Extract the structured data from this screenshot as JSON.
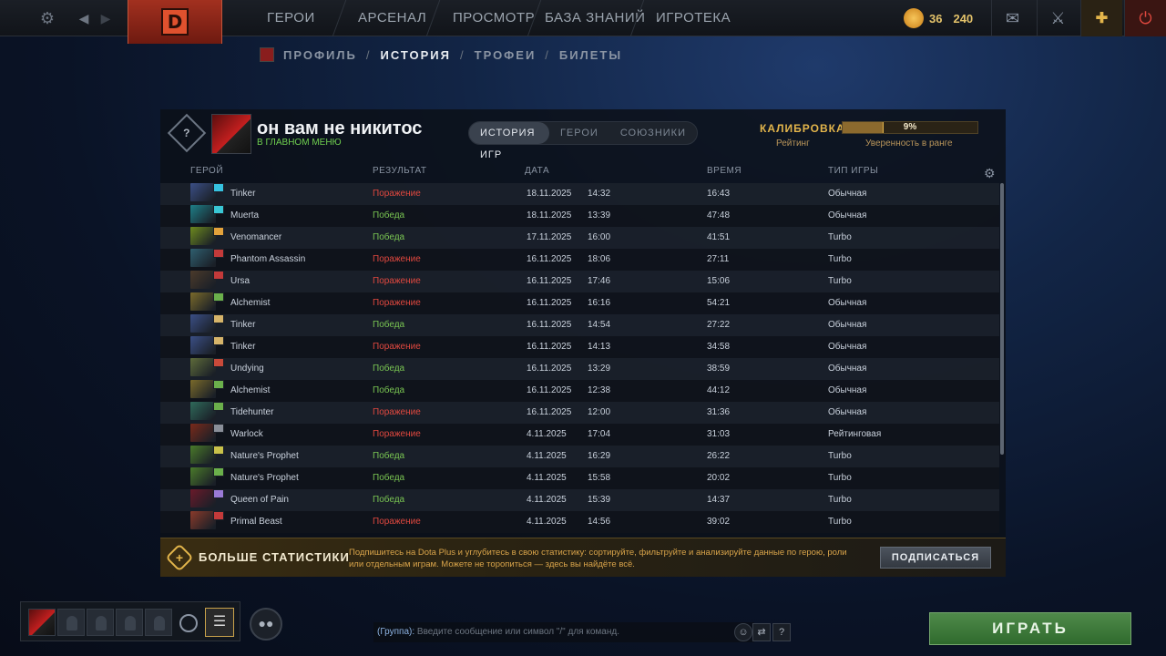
{
  "topbar": {
    "nav": [
      "ГЕРОИ",
      "АРСЕНАЛ",
      "ПРОСМОТР",
      "БАЗА ЗНАНИЙ",
      "ИГРОТЕКА"
    ],
    "currency": {
      "shards": "36",
      "gold": "240"
    }
  },
  "subnav": {
    "items": [
      "ПРОФИЛЬ",
      "ИСТОРИЯ",
      "ТРОФЕИ",
      "БИЛЕТЫ"
    ],
    "active": 1
  },
  "profile": {
    "name": "он вам не никитос",
    "status": "В ГЛАВНОМ МЕНЮ"
  },
  "tabs": [
    "ИСТОРИЯ ИГР",
    "ГЕРОИ",
    "СОЮЗНИКИ"
  ],
  "calibration": {
    "title": "КАЛИБРОВКА",
    "rating_label": "Рейтинг",
    "confidence_label": "Уверенность в ранге",
    "percent": "9%",
    "fraction": 0.3
  },
  "table": {
    "headers": {
      "hero": "ГЕРОЙ",
      "result": "РЕЗУЛЬТАТ",
      "date": "ДАТА",
      "time": "ВРЕМЯ",
      "type": "ТИП ИГРЫ"
    },
    "rows": [
      {
        "hero": "Tinker",
        "result": "Поражение",
        "win": false,
        "date": "18.11.2025",
        "clock": "14:32",
        "duration": "16:43",
        "type": "Обычная",
        "c1": "#3b4f86",
        "c2": "#36c2e0"
      },
      {
        "hero": "Muerta",
        "result": "Победа",
        "win": true,
        "date": "18.11.2025",
        "clock": "13:39",
        "duration": "47:48",
        "type": "Обычная",
        "c1": "#1e7f88",
        "c2": "#39c7d5"
      },
      {
        "hero": "Venomancer",
        "result": "Победа",
        "win": true,
        "date": "17.11.2025",
        "clock": "16:00",
        "duration": "41:51",
        "type": "Turbo",
        "c1": "#6d8a1e",
        "c2": "#e3a23b"
      },
      {
        "hero": "Phantom Assassin",
        "result": "Поражение",
        "win": false,
        "date": "16.11.2025",
        "clock": "18:06",
        "duration": "27:11",
        "type": "Turbo",
        "c1": "#2f5f6f",
        "c2": "#c33a3a"
      },
      {
        "hero": "Ursa",
        "result": "Поражение",
        "win": false,
        "date": "16.11.2025",
        "clock": "17:46",
        "duration": "15:06",
        "type": "Turbo",
        "c1": "#4b3a2a",
        "c2": "#c33a3a"
      },
      {
        "hero": "Alchemist",
        "result": "Поражение",
        "win": false,
        "date": "16.11.2025",
        "clock": "16:16",
        "duration": "54:21",
        "type": "Обычная",
        "c1": "#7a6a2a",
        "c2": "#6bb04b"
      },
      {
        "hero": "Tinker",
        "result": "Победа",
        "win": true,
        "date": "16.11.2025",
        "clock": "14:54",
        "duration": "27:22",
        "type": "Обычная",
        "c1": "#3b4f86",
        "c2": "#d6b46a"
      },
      {
        "hero": "Tinker",
        "result": "Поражение",
        "win": false,
        "date": "16.11.2025",
        "clock": "14:13",
        "duration": "34:58",
        "type": "Обычная",
        "c1": "#3b4f86",
        "c2": "#d6b46a"
      },
      {
        "hero": "Undying",
        "result": "Победа",
        "win": true,
        "date": "16.11.2025",
        "clock": "13:29",
        "duration": "38:59",
        "type": "Обычная",
        "c1": "#5e6b3a",
        "c2": "#c94a3a"
      },
      {
        "hero": "Alchemist",
        "result": "Победа",
        "win": true,
        "date": "16.11.2025",
        "clock": "12:38",
        "duration": "44:12",
        "type": "Обычная",
        "c1": "#7a6a2a",
        "c2": "#6bb04b"
      },
      {
        "hero": "Tidehunter",
        "result": "Поражение",
        "win": false,
        "date": "16.11.2025",
        "clock": "12:00",
        "duration": "31:36",
        "type": "Обычная",
        "c1": "#2f6a5a",
        "c2": "#6bb04b"
      },
      {
        "hero": "Warlock",
        "result": "Поражение",
        "win": false,
        "date": "4.11.2025",
        "clock": "17:04",
        "duration": "31:03",
        "type": "Рейтинговая",
        "c1": "#7a2a1a",
        "c2": "#8a8f99"
      },
      {
        "hero": "Nature's Prophet",
        "result": "Победа",
        "win": true,
        "date": "4.11.2025",
        "clock": "16:29",
        "duration": "26:22",
        "type": "Turbo",
        "c1": "#4a7a2a",
        "c2": "#c9c24a"
      },
      {
        "hero": "Nature's Prophet",
        "result": "Победа",
        "win": true,
        "date": "4.11.2025",
        "clock": "15:58",
        "duration": "20:02",
        "type": "Turbo",
        "c1": "#4a7a2a",
        "c2": "#6bb04b"
      },
      {
        "hero": "Queen of Pain",
        "result": "Победа",
        "win": true,
        "date": "4.11.2025",
        "clock": "15:39",
        "duration": "14:37",
        "type": "Turbo",
        "c1": "#6a1a2a",
        "c2": "#9a7ad6"
      },
      {
        "hero": "Primal Beast",
        "result": "Поражение",
        "win": false,
        "date": "4.11.2025",
        "clock": "14:56",
        "duration": "39:02",
        "type": "Turbo",
        "c1": "#8a3a2a",
        "c2": "#c33a3a"
      }
    ]
  },
  "plus": {
    "title": "БОЛЬШЕ СТАТИСТИКИ",
    "desc": "Подпишитесь на Dota Plus и углубитесь в свою статистику: сортируйте, фильтруйте и анализируйте данные по герою, роли или отдельным играм. Можете не торопиться — здесь вы найдёте всё.",
    "button": "ПОДПИСАТЬСЯ"
  },
  "chat": {
    "group": "(Группа):",
    "placeholder": "Введите сообщение или символ \"/\" для команд."
  },
  "play": "ИГРАТЬ"
}
